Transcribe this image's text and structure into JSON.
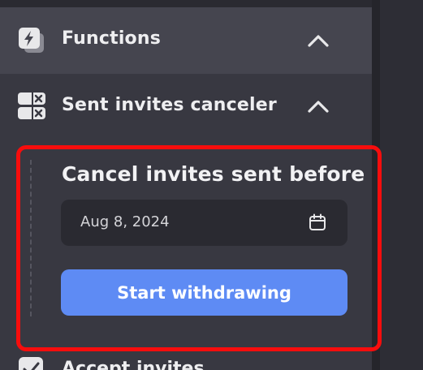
{
  "sidebar": {
    "functions": {
      "label": "Functions",
      "icon": "lightning-icon",
      "expanded": true
    },
    "sent_invites_canceler": {
      "label": "Sent invites canceler",
      "icon": "cancel-grid-icon",
      "expanded": true
    },
    "accept_invites": {
      "label": "Accept invites",
      "icon": "check-icon"
    }
  },
  "panel": {
    "title": "Cancel invites sent before",
    "date_value": "Aug 8, 2024",
    "start_button_label": "Start withdrawing"
  },
  "colors": {
    "background": "#383841",
    "active_row": "#45454f",
    "input_bg": "#2a2a31",
    "primary_button": "#5e8bf4",
    "highlight_border": "#f70d0d"
  }
}
